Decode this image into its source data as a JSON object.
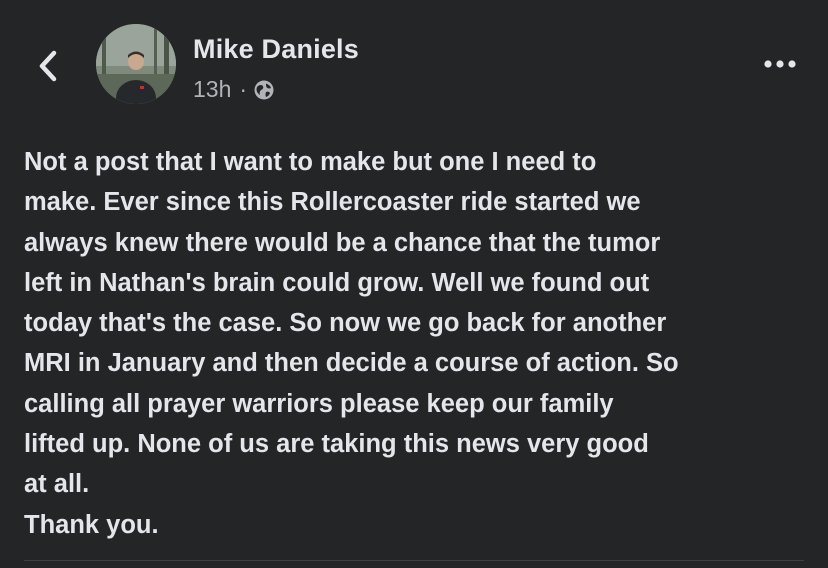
{
  "author": {
    "name": "Mike Daniels",
    "time": "13h",
    "separator": "·",
    "privacy_icon": "globe-icon"
  },
  "post": {
    "lines": [
      "Not a post that I want to make but one I need to",
      "make. Ever since this Rollercoaster ride started we",
      "always knew there would be a chance that the tumor",
      "left in Nathan's brain could grow. Well we found out",
      "today that's the case. So now we go back for another",
      "MRI in January and then decide a course of action. So",
      "calling all prayer warriors please keep our family",
      "lifted up. None of us are taking this news very good",
      "at all.",
      "Thank you."
    ]
  },
  "icons": {
    "back": "chevron-left-icon",
    "more": "more-options-icon"
  },
  "colors": {
    "background": "#242526",
    "primary_text": "#e4e6eb",
    "secondary_text": "#b0b3b8"
  }
}
